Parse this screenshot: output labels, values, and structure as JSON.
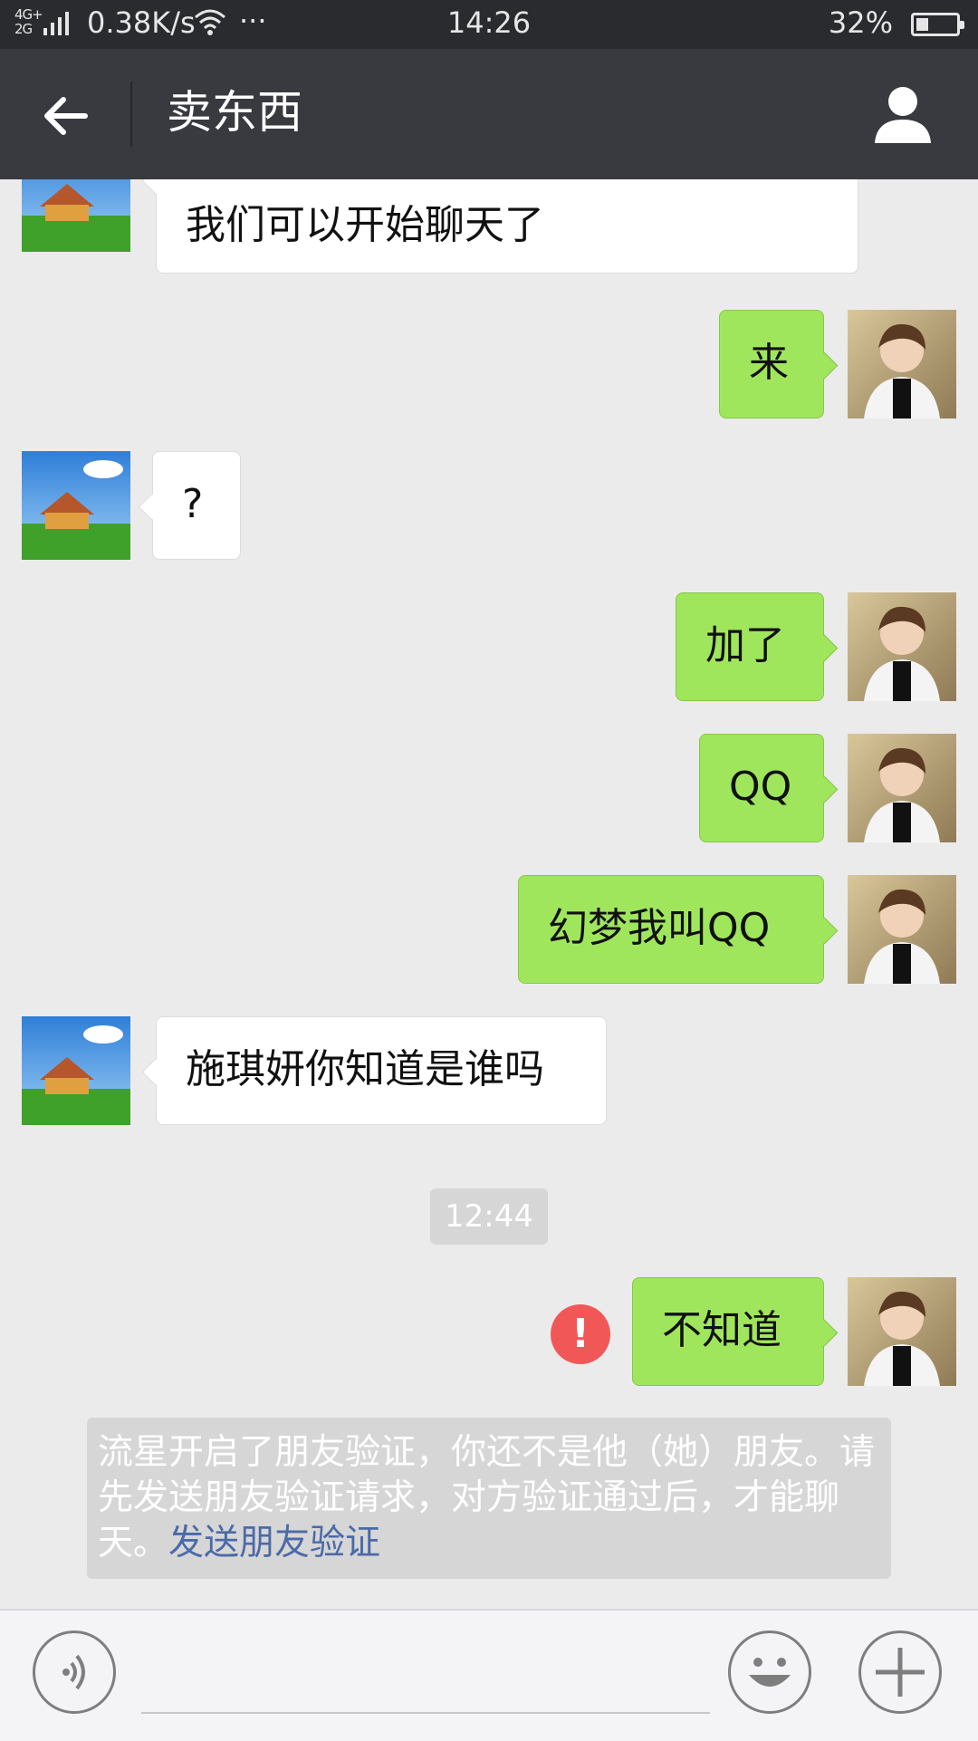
{
  "status_bar": {
    "network": "4G+ 2G",
    "speed": "0.38K/s",
    "more": "···",
    "time": "14:26",
    "battery": "32%",
    "battery_level": 0.32
  },
  "header": {
    "back_icon": "arrow-left-icon",
    "title": "卖东西",
    "profile_icon": "person-icon"
  },
  "messages": [
    {
      "from": "other",
      "text": "我们可以开始聊天了"
    },
    {
      "from": "self",
      "text": "来"
    },
    {
      "from": "other",
      "text": "?"
    },
    {
      "from": "self",
      "text": "加了"
    },
    {
      "from": "self",
      "text": "QQ"
    },
    {
      "from": "self",
      "text": "幻梦我叫QQ"
    },
    {
      "from": "other",
      "text": "施琪妍你知道是谁吗"
    },
    {
      "from": "self",
      "text": "不知道",
      "failed": true
    }
  ],
  "timestamp": "12:44",
  "system_notice": {
    "text": "流星开启了朋友验证，你还不是他（她）朋友。请先发送朋友验证请求，对方验证通过后，才能聊天。",
    "link": "发送朋友验证"
  },
  "input_bar": {
    "voice_icon": "voice-icon",
    "emoji_icon": "smiley-icon",
    "plus_icon": "plus-icon",
    "input_value": ""
  },
  "colors": {
    "header_bg": "#393a3f",
    "outgoing_bubble": "#9fe65d",
    "incoming_bubble": "#ffffff",
    "chat_bg": "#ebebeb",
    "error": "#f25757",
    "link": "#4a6aa8"
  }
}
